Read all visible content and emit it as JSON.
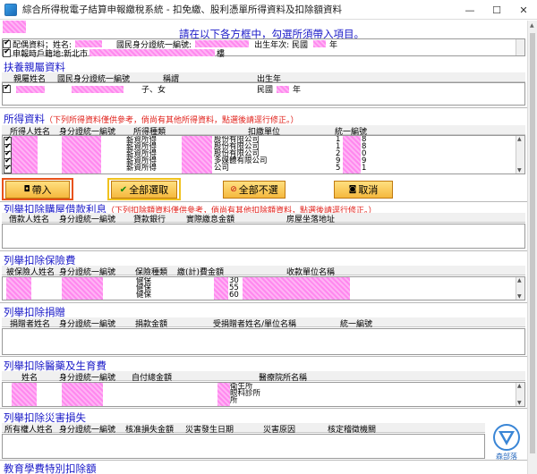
{
  "window": {
    "title": "綜合所得稅電子結算申報繳稅系統 - 扣免繳、股利憑單所得資料及扣除額資料",
    "minimize": "—",
    "maximize": "☐",
    "close": "✕"
  },
  "instruction": "請在以下各方框中，勾選所須帶入項目。",
  "top_info": {
    "line1": {
      "spouse_prefix": "配偶資料；姓名:",
      "id_label": "國民身分證統一編號:",
      "birth_label": "出生年次: 民國",
      "year_suffix": "年"
    },
    "line2": {
      "prefix": "申報時戶籍地:新北市",
      "suffix": "樓"
    }
  },
  "dependents": {
    "title": "扶養親屬資料",
    "columns": [
      "親屬姓名",
      "國民身分證統一編號",
      "稱謂",
      "出生年"
    ],
    "row": {
      "relation": "子、女",
      "birth_prefix": "民國",
      "birth_suffix": "年"
    }
  },
  "income": {
    "title": "所得資料",
    "note": "（下列所得資料僅供參考，倘尚有其他所得資料，點選後請逕行修正。）",
    "columns": [
      "所得人姓名",
      "身分證統一編號",
      "所得種類",
      "扣繳單位",
      "統一編號"
    ],
    "rows": [
      {
        "type": "薪資所得",
        "payer": "股份有限公司",
        "code_a": "1",
        "code_b": "8"
      },
      {
        "type": "薪資所得",
        "payer": "股份有限公司",
        "code_a": "1",
        "code_b": "8"
      },
      {
        "type": "薪資所得",
        "payer": "股份有限公司",
        "code_a": "2",
        "code_b": "0"
      },
      {
        "type": "薪資所得",
        "payer": "多媒體有限公司",
        "code_a": "9",
        "code_b": "9"
      },
      {
        "type": "薪資所得",
        "payer": "公司",
        "code_a": "5",
        "code_b": "1"
      }
    ]
  },
  "buttons": {
    "import": "帶入",
    "select_all": "全部選取",
    "deselect_all": "全部不選",
    "cancel": "取消"
  },
  "highlight_colors": {
    "import": "#e8521a",
    "select_all": "#f0c21e"
  },
  "housing_loan": {
    "title": "列舉扣除購屋借款利息",
    "note": "（下列扣除額資料僅供參考，倘尚有其他扣除額資料，點選後請逕行修正。）",
    "columns": [
      "借款人姓名",
      "身分證統一編號",
      "貸款銀行",
      "實際繳息金額",
      "房屋坐落地址"
    ]
  },
  "insurance": {
    "title": "列舉扣除保險費",
    "columns": [
      "被保險人姓名",
      "身分證統一編號",
      "保險種類",
      "繳(計)費金額",
      "收款單位名稱"
    ],
    "rows": [
      {
        "kind": "健保",
        "amount": "30"
      },
      {
        "kind": "健保",
        "amount": "55"
      },
      {
        "kind": "健保",
        "amount": "60"
      }
    ]
  },
  "donation": {
    "title": "列舉扣除捐贈",
    "columns": [
      "捐贈者姓名",
      "身分證統一編號",
      "捐款金額",
      "受捐贈者姓名/單位名稱",
      "統一編號"
    ]
  },
  "medical": {
    "title": "列舉扣除醫藥及生育費",
    "columns": [
      "姓名",
      "身分證統一編號",
      "自付總金額",
      "醫療院所名稱"
    ],
    "rows": [
      {
        "hospital": "衛生所"
      },
      {
        "hospital": "眼科診所"
      },
      {
        "hospital": "所"
      }
    ]
  },
  "disaster": {
    "title": "列舉扣除災害損失",
    "columns": [
      "所有權人姓名",
      "身分證統一編號",
      "核准損失金額",
      "災害發生日期",
      "災害原因",
      "核定稽徵機關"
    ]
  },
  "education": {
    "title": "教育學費特別扣除額"
  },
  "watermark": {
    "text": "森部落"
  }
}
